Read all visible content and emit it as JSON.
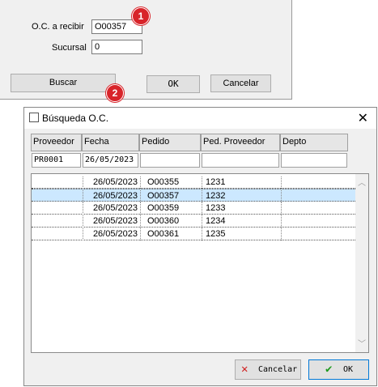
{
  "back": {
    "oc_label": "O.C. a recibir",
    "oc_value": "O00357",
    "sucursal_label": "Sucursal",
    "sucursal_value": "0",
    "buscar": "Buscar",
    "ok": "OK",
    "cancelar": "Cancelar",
    "badge1": "1",
    "badge2": "2"
  },
  "dialog": {
    "title": "Búsqueda O.C.",
    "headers": [
      "Proveedor",
      "Fecha",
      "Pedido",
      "Ped. Proveedor",
      "Depto"
    ],
    "filters": [
      "PR0001",
      "26/05/2023",
      "",
      "",
      ""
    ],
    "rows": [
      [
        "",
        "26/05/2023",
        "O00355",
        "1231",
        ""
      ],
      [
        "",
        "26/05/2023",
        "O00357",
        "1232",
        ""
      ],
      [
        "",
        "26/05/2023",
        "O00359",
        "1233",
        ""
      ],
      [
        "",
        "26/05/2023",
        "O00360",
        "1234",
        ""
      ],
      [
        "",
        "26/05/2023",
        "O00361",
        "1235",
        ""
      ]
    ],
    "selected_row": 1,
    "cancelar": "Cancelar",
    "ok": "OK"
  }
}
